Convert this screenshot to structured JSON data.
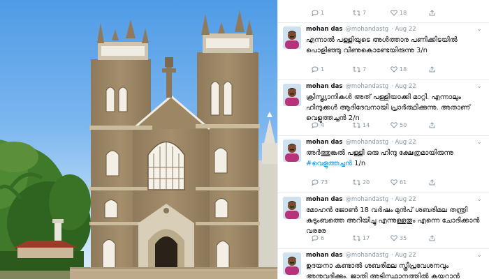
{
  "photo": {
    "alt_subject": "church"
  },
  "colors": {
    "accent": "#1b95e0",
    "text": "#14171a",
    "muted": "#8899a6"
  },
  "tweets": [
    {
      "partial": true,
      "actions": {
        "reply": "1",
        "retweet": "7",
        "like": "18"
      }
    },
    {
      "name": "mohan das",
      "handle": "@mohandastg",
      "date": "Aug 22",
      "text": "എന്നാൽ പള്ളിയുടെ അൾത്താര പണിക്കിടയിൽ പൊളിഞ്ഞു വീണുകൊണ്ടേയിരുന്നു",
      "time": "3/n",
      "actions": {
        "reply": "1",
        "retweet": "7",
        "like": "18"
      }
    },
    {
      "name": "mohan das",
      "handle": "@mohandastg",
      "date": "Aug 22",
      "text": "ക്രിസ്ത്യാനികൾ അത് പള്ളിയാക്കി മാറ്റി. എന്നാലും ഹിന്ദുക്കൾ ആദിദേവനായി പ്രാർത്ഥിക്കുന്നു. അതാണ് വെളുത്തച്ചൻ",
      "time": "2/n",
      "actions": {
        "reply": "4",
        "retweet": "14",
        "like": "50"
      }
    },
    {
      "name": "mohan das",
      "handle": "@mohandastg",
      "date": "Aug 22",
      "text": "അർത്തുങ്കൽ പള്ളി ഒരു ഹിന്ദു ക്ഷേത്രമായിരുന്നു",
      "hashtag": "#വെളുത്തച്ചൻ",
      "time": "1/n",
      "actions": {
        "reply": "73",
        "retweet": "20",
        "like": "61"
      }
    },
    {
      "name": "mohan das",
      "handle": "@mohandastg",
      "date": "Aug 22",
      "text": "മോഹൻ ജോൺ 18 വർഷം മുൻപ് ശബരിമല തന്ത്രി കുടുംബത്തെ അറിയിച്ചു എന്നുള്ളതും എന്നെ ചോദിക്കാൻ വരരേ",
      "actions": {
        "reply": "6",
        "retweet": "17",
        "like": "35"
      }
    },
    {
      "name": "mohan das",
      "handle": "@mohandastg",
      "date": "Aug 22",
      "text": "ഉദയനാ കണ്ടാൽ ശബരിമല സ്ത്രീപ്രവേശനവും അനുവദിക്കും. ജാതി അടിസ്ഥാനത്തിൽ കയറാൻ കഴിയും"
    }
  ]
}
